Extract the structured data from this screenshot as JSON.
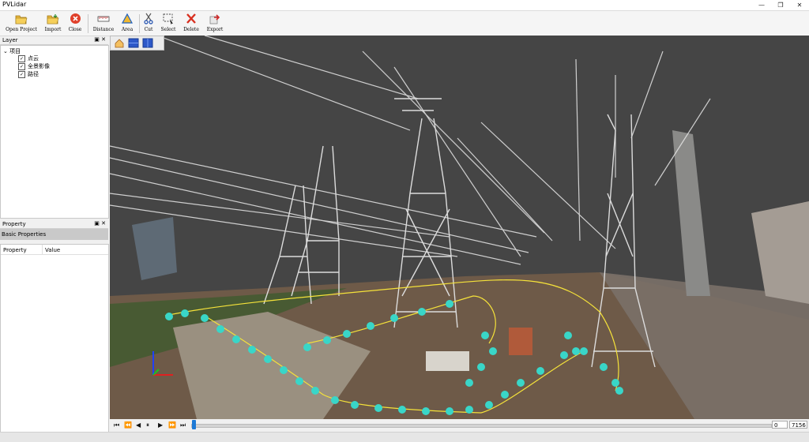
{
  "window": {
    "title": "PVLidar",
    "minimize": "—",
    "restore": "❐",
    "close": "✕"
  },
  "toolbar": {
    "open_project": "Open Project",
    "import": "Import",
    "close": "Close",
    "distance": "Distance",
    "area": "Area",
    "cut": "Cut",
    "select": "Select",
    "delete": "Delete",
    "export": "Export"
  },
  "layer_panel": {
    "title": "Layer",
    "controls": "▣ ✕",
    "root": "项目",
    "expander": "⌄",
    "items": [
      "点云",
      "全景影像",
      "路径"
    ],
    "check": "✓"
  },
  "property_panel": {
    "title": "Property",
    "controls": "▣ ✕",
    "section": "Basic Properties",
    "col_property": "Property",
    "col_value": "Value"
  },
  "playback": {
    "first": "⏮",
    "rewind": "⏪",
    "back": "◀",
    "pause": "⏸",
    "play": "▶",
    "forward": "⏩",
    "last": "⏭",
    "current_frame": "0",
    "total_frames": "7156",
    "progress": 0
  },
  "colors": {
    "viewport_bg": "#454545",
    "trajectory_cyan": "#39d6c8",
    "trajectory_yellow": "#f5e23a",
    "slider_accent": "#1e7ad6"
  }
}
